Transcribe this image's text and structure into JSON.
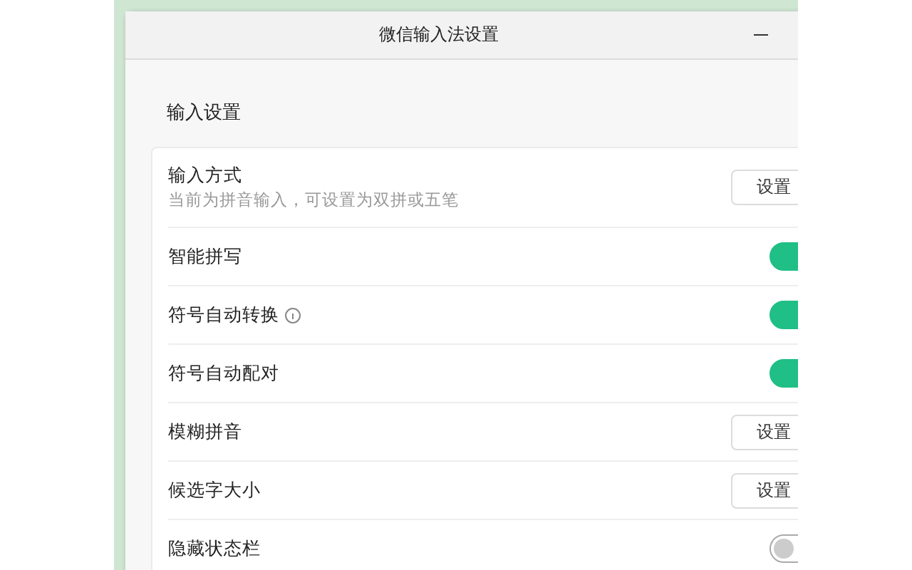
{
  "window": {
    "title": "微信输入法设置"
  },
  "section": {
    "title": "输入设置"
  },
  "rows": [
    {
      "kind": "button",
      "label": "输入方式",
      "description": "当前为拼音输入，可设置为双拼或五笔",
      "button": "设置"
    },
    {
      "kind": "toggle",
      "label": "智能拼写",
      "on": true
    },
    {
      "kind": "toggle",
      "label": "符号自动转换",
      "info": true,
      "on": true
    },
    {
      "kind": "toggle",
      "label": "符号自动配对",
      "on": true
    },
    {
      "kind": "button",
      "label": "模糊拼音",
      "button": "设置"
    },
    {
      "kind": "button",
      "label": "候选字大小",
      "button": "设置"
    },
    {
      "kind": "toggle",
      "label": "隐藏状态栏",
      "on": false
    }
  ]
}
